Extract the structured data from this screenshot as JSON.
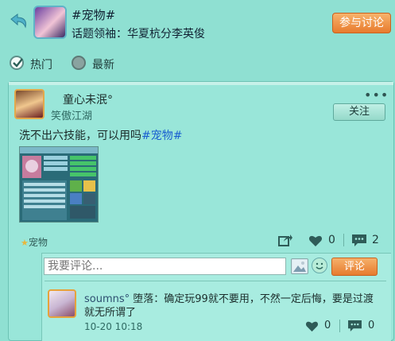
{
  "header": {
    "topic_title": "#宠物#",
    "leader_label": "话题领袖：华夏杭分李英俊",
    "join_label": "参与讨论"
  },
  "filters": {
    "hot_label": "热门",
    "new_label": "最新",
    "selected": "热门"
  },
  "post": {
    "author": "童心未泯°",
    "guild": "笑傲江湖",
    "more_label": "•••",
    "follow_label": "关注",
    "text_prefix": "洗不出六技能，可以用吗",
    "text_tag": "#宠物#",
    "category_tag": "宠物",
    "like_count": "0",
    "comment_count": "2"
  },
  "comment_box": {
    "placeholder": "我要评论...",
    "submit_label": "评论"
  },
  "reply": {
    "name": "soumns°",
    "message": " 堕落：确定玩99就不要用，不然一定后悔，要是过渡就无所谓了",
    "time": "10-20 10:18",
    "like_count": "0",
    "comment_count": "0"
  },
  "colors": {
    "background": "#8fe0d2",
    "accent_orange": "#e87b2e",
    "tag_blue": "#1a5fd0"
  }
}
